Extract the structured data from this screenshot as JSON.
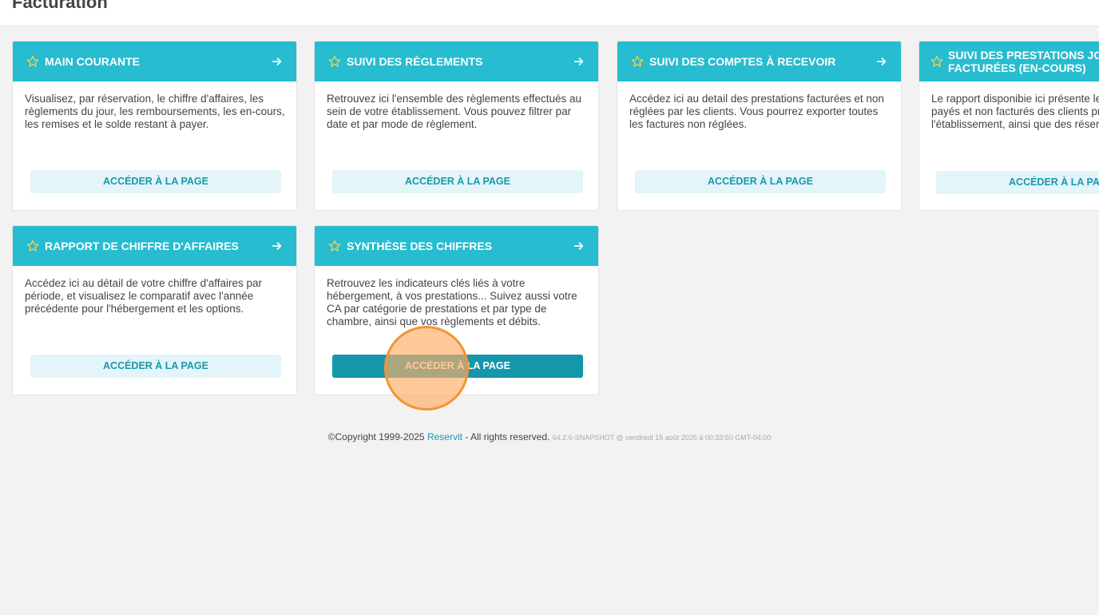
{
  "page": {
    "title": "Facturation"
  },
  "colors": {
    "header": "#27bccf",
    "button_bg": "#e3f5f8",
    "button_text": "#1a98ad",
    "button_active_bg": "#1497ab",
    "star": "#f2d24b",
    "click_marker": "#f39432"
  },
  "cards": [
    {
      "icon": "star-icon",
      "title": "MAIN COURANTE",
      "arrow_icon": "arrow-right-icon",
      "description": "Visualisez, par réservation, le chiffre d'affaires, les règlements du jour, les remboursements, les en-cours, les remises et le solde restant à payer.",
      "button": "ACCÉDER À LA PAGE"
    },
    {
      "icon": "star-icon",
      "title": "SUIVI DES RÈGLEMENTS",
      "arrow_icon": "arrow-right-icon",
      "description": "Retrouvez ici l'ensemble des règlements effectués au sein de votre établissement. Vous pouvez filtrer par date et par mode de règlement.",
      "button": "ACCÉDER À LA PAGE"
    },
    {
      "icon": "star-icon",
      "title": "SUIVI DES COMPTES À RECEVOIR",
      "arrow_icon": "arrow-right-icon",
      "description": "Accédez ici au detail des prestations facturées et non réglées par les clients. Vous pourrez exporter toutes les factures non réglées.",
      "button": "ACCÉDER À LA PAGE"
    },
    {
      "icon": "star-icon",
      "title": "SUIVI DES PRESTATIONS JOURNALIÈRES NON FACTURÉES (EN-COURS)",
      "arrow_icon": "arrow-right-icon",
      "description": "Le rapport disponibie ici présente les montants non payés et non facturés des clients présents dans l'établissement, ainsi que des réservations passées.",
      "button": "ACCÉDER À LA PAGE"
    },
    {
      "icon": "star-icon",
      "title": "RAPPORT DE CHIFFRE D'AFFAIRES",
      "arrow_icon": "arrow-right-icon",
      "description": "Accédez ici au détail de votre chiffre d'affaires par période, et visualisez le comparatif avec l'année précédente pour l'hébergement et les options.",
      "button": "ACCÉDER À LA PAGE"
    },
    {
      "icon": "star-icon",
      "title": "SYNTHÈSE DES CHIFFRES",
      "arrow_icon": "arrow-right-icon",
      "description": "Retrouvez les indicateurs clés liés à votre hébergement, à vos prestations... Suivez aussi votre CA par catégorie de prestations et par type de chambre, ainsi que vos règlements et débits.",
      "button": "ACCÉDER À LA PAGE"
    }
  ],
  "footer": {
    "copyright": "©Copyright 1999-2025 ",
    "brand": "Reservit",
    "rights": " - All rights reserved. ",
    "version": "64.2.6-SNAPSHOT @ vendredi 15 août 2025 à 00:33:50 GMT-04:00"
  }
}
